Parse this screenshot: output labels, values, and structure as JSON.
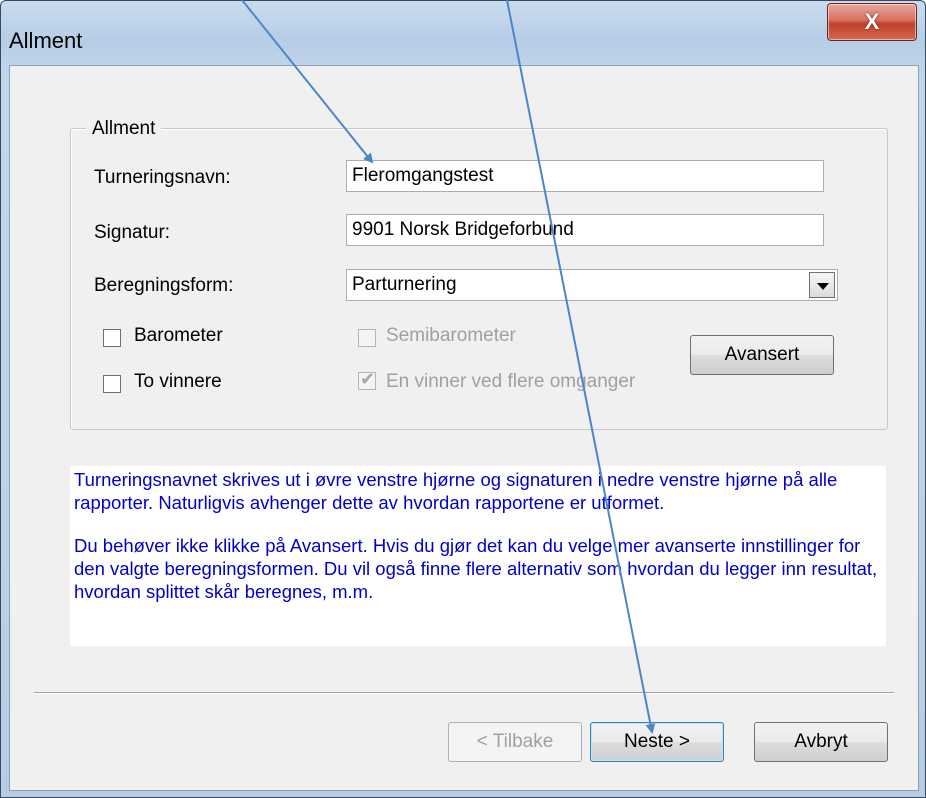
{
  "window": {
    "title": "Allment",
    "close_glyph": "X"
  },
  "group": {
    "legend": "Allment",
    "tournament_name_label": "Turneringsnavn:",
    "tournament_name_value": "Fleromgangstest",
    "signature_label": "Signatur:",
    "signature_value": "9901 Norsk Bridgeforbund",
    "calc_form_label": "Beregningsform:",
    "calc_form_value": "Parturnering"
  },
  "options": {
    "barometer": {
      "label": "Barometer",
      "checked": false,
      "enabled": true
    },
    "semibarometer": {
      "label": "Semibarometer",
      "checked": false,
      "enabled": false
    },
    "two_winners": {
      "label": "To vinnere",
      "checked": false,
      "enabled": true
    },
    "one_winner_multi": {
      "label": "En vinner ved flere omganger",
      "checked": true,
      "enabled": false
    }
  },
  "advanced_button": "Avansert",
  "info": {
    "paragraph1": "Turneringsnavnet skrives ut i øvre venstre hjørne og signaturen i nedre venstre hjørne på alle rapporter. Naturligvis avhenger dette av hvordan rapportene er utformet.",
    "paragraph2": "Du behøver ikke klikke på Avansert. Hvis du gjør det kan du velge mer avanserte innstillinger for den valgte beregningsformen. Du vil også finne flere alternativ som hvordan du legger inn resultat, hvordan splittet skår beregnes, m.m."
  },
  "footer": {
    "back": "< Tilbake",
    "next": "Neste >",
    "cancel": "Avbryt"
  },
  "colors": {
    "info_text": "#0000cc",
    "annotation_arrow": "#4a86c8"
  }
}
